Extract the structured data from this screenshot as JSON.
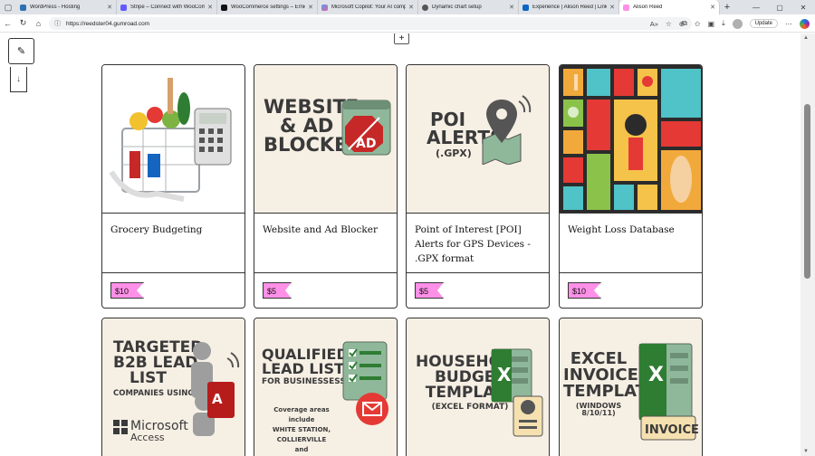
{
  "browser": {
    "tabs": [
      {
        "label": "WordPress - Hosting",
        "color": "#2d6fb3"
      },
      {
        "label": "Stripe – Connect with WooComm",
        "color": "#635bff"
      },
      {
        "label": "WooCommerce settings – Ernie N",
        "color": "#111111"
      },
      {
        "label": "Microsoft Copilot: Your AI comp",
        "color": "#4f9cf9"
      },
      {
        "label": "Dynamic chart setup",
        "color": "#555555"
      },
      {
        "label": "Experience | Alison Reed | Linked",
        "color": "#0a66c2"
      },
      {
        "label": "Alison Reed",
        "color": "#ff90e8",
        "active": true
      }
    ],
    "url": "https://reedster04.gumroad.com",
    "update_label": "Update"
  },
  "products": [
    {
      "title": "Grocery Budgeting",
      "price": "$10"
    },
    {
      "title": "Website and Ad Blocker",
      "price": "$5"
    },
    {
      "title": "Point of Interest [POI] Alerts for GPS Devices - .GPX format",
      "price": "$5"
    },
    {
      "title": "Weight Loss Database",
      "price": "$10"
    }
  ],
  "thumbs": {
    "website": {
      "line1": "WEBSITE",
      "line2": "& AD",
      "line3": "BLOCKER",
      "badge": "AD"
    },
    "poi": {
      "line1": "POI",
      "line2": "ALERTS",
      "line3": "(.GPX)"
    },
    "b2b": {
      "line1": "TARGETED",
      "line2": "B2B LEAD",
      "line3": "LIST",
      "line4": "COMPANIES USING",
      "brand1": "Microsoft",
      "brand2": "Access",
      "badge": "A"
    },
    "qualified": {
      "line1": "QUALIFIED",
      "line2": "LEAD LIST",
      "line3": "FOR BUSINESSESS",
      "line4": "Coverage areas include",
      "line5": "WHITE STATION,",
      "line6": "COLLIERVILLE",
      "line7": "and GERMANTOWN, TN"
    },
    "household": {
      "line1": "HOUSEHOLD",
      "line2": "BUDGET",
      "line3": "TEMPLATE",
      "line4": "(EXCEL FORMAT)",
      "badge": "X"
    },
    "invoice": {
      "line1": "EXCEL",
      "line2": "INVOICE",
      "line3": "TEMPLATE",
      "line4": "(WINDOWS 8/10/11)",
      "badge": "X",
      "tag": "INVOICE"
    }
  }
}
